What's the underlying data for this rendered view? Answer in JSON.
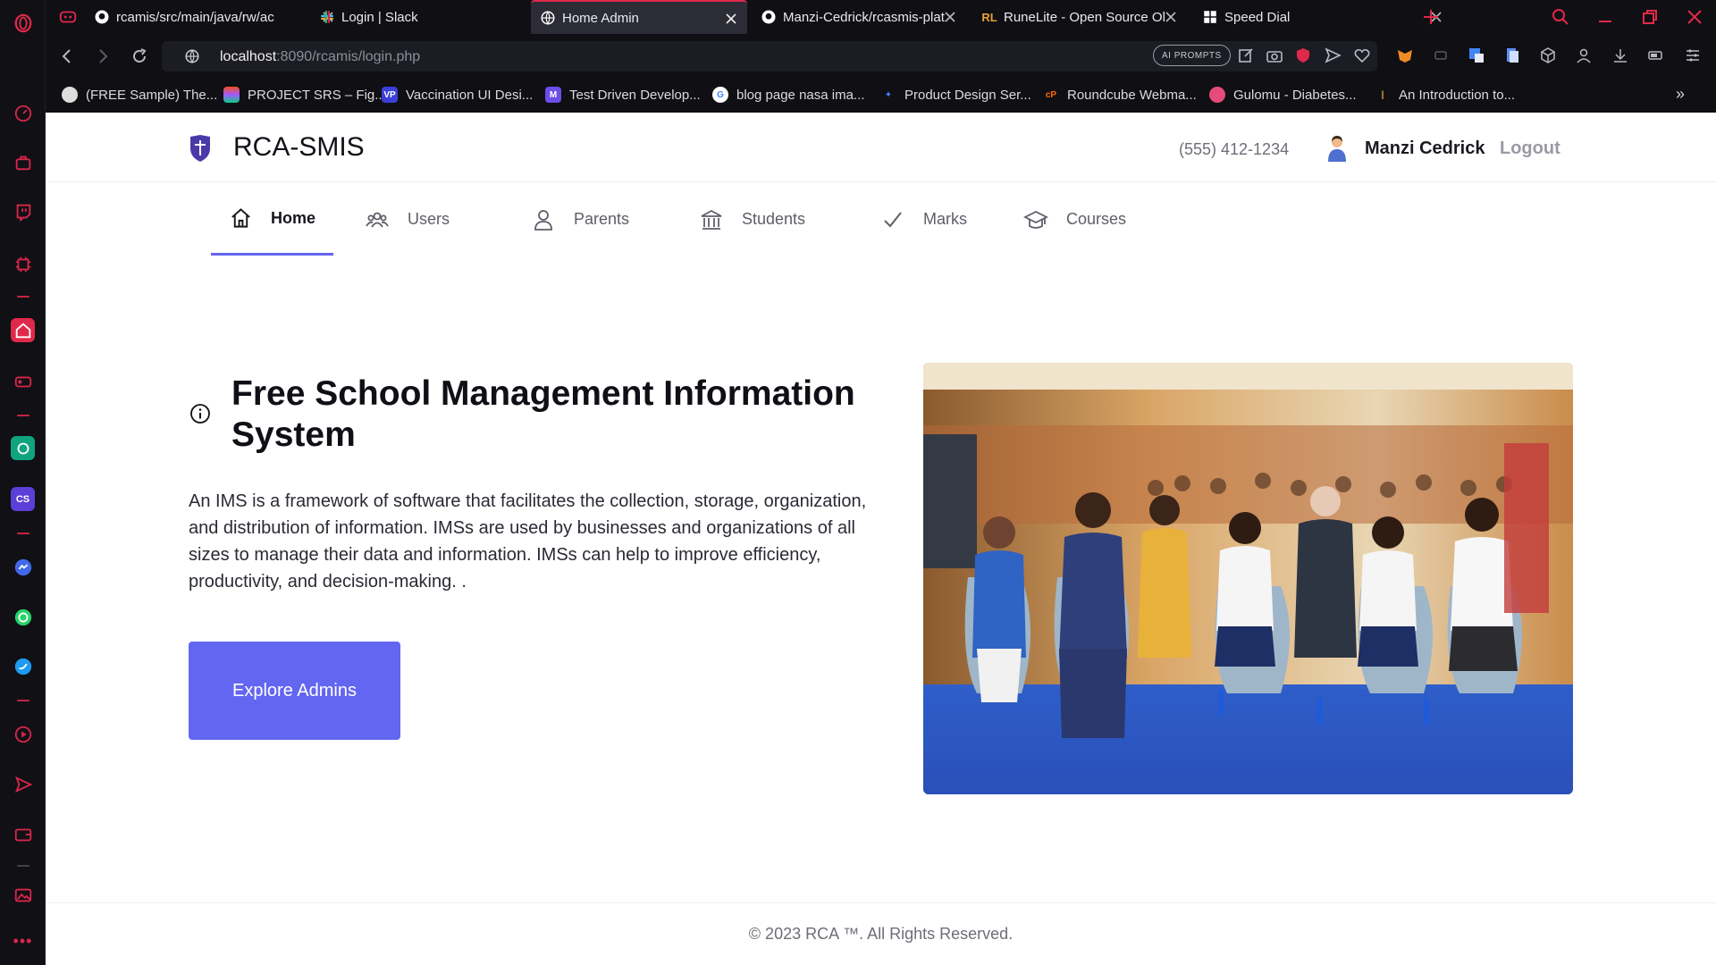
{
  "browser": {
    "tabs": [
      {
        "label": "rcamis/src/main/java/rw/ac",
        "icon": "github-icon"
      },
      {
        "label": "Login | Slack",
        "icon": "slack-icon"
      },
      {
        "label": "Home Admin",
        "icon": "globe-icon",
        "active": true
      },
      {
        "label": "Manzi-Cedrick/rcasmis-plat",
        "icon": "github-icon"
      },
      {
        "label": "RuneLite - Open Source Ol",
        "icon": "runelite-icon"
      },
      {
        "label": "Speed Dial",
        "icon": "speed-dial-icon"
      }
    ],
    "url_host": "localhost",
    "url_rest": ":8090/rcamis/login.php",
    "ai_prompts": "AI PROMPTS",
    "bookmarks": [
      "(FREE Sample) The...",
      "PROJECT SRS – Fig...",
      "Vaccination UI Desi...",
      "Test Driven Develop...",
      "blog page nasa ima...",
      "Product Design Ser...",
      "Roundcube Webma...",
      "Gulomu - Diabetes...",
      "An Introduction to..."
    ],
    "accent": "#e0294a"
  },
  "site": {
    "title": "RCA-SMIS",
    "phone": "(555) 412-1234",
    "user_name": "Manzi Cedrick",
    "logout": "Logout",
    "nav": [
      "Home",
      "Users",
      "Parents",
      "Students",
      "Marks",
      "Courses"
    ],
    "hero_title": "Free School Management Information System",
    "hero_desc": "An IMS is a framework of software that facilitates the collection, storage, organization, and distribution of information. IMSs are used by businesses and organizations of all sizes to manage their data and information. IMSs can help to improve efficiency, productivity, and decision-making. .",
    "cta": "Explore Admins",
    "footer": "© 2023 RCA ™. All Rights Reserved.",
    "accent": "#6366f1"
  }
}
